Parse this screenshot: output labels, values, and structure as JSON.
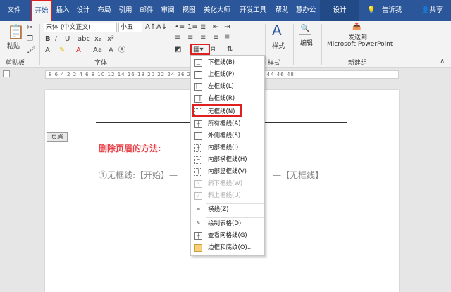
{
  "tabs": [
    "文件",
    "开始",
    "插入",
    "设计",
    "布局",
    "引用",
    "邮件",
    "审阅",
    "视图",
    "美化大师",
    "开发工具",
    "帮助",
    "慧办公",
    "设计"
  ],
  "active_tab": "开始",
  "tell_me": "告诉我",
  "share": "共享",
  "clipboard": {
    "paste_label": "粘贴",
    "group_label": "剪贴板"
  },
  "font": {
    "family": "宋体 (中文正文)",
    "size": "小五",
    "group_label": "字体",
    "aa_label": "Aa"
  },
  "styles": {
    "label": "样式",
    "group_label": "样式"
  },
  "editing": {
    "label": "编辑"
  },
  "send": {
    "line1": "发送到",
    "line2": "Microsoft PowerPoint",
    "group_label": "新建组"
  },
  "ruler_text": "8 6 4 2 2 4 6 8 10 12 14 16 18 20 22 24 26 28 30 32 34 36 38 40 42 44 46 48",
  "document": {
    "header_tag": "页眉",
    "heading": "删除页眉的方法:",
    "line_part1": "①无框线:【开始】—",
    "line_part2": "—【无框线】"
  },
  "border_menu": {
    "items": [
      {
        "label": "下框线(B)",
        "icon": "bottom-border-icon",
        "disabled": false
      },
      {
        "label": "上框线(P)",
        "icon": "top-border-icon",
        "disabled": false
      },
      {
        "label": "左框线(L)",
        "icon": "left-border-icon",
        "disabled": false
      },
      {
        "label": "右框线(R)",
        "icon": "right-border-icon",
        "disabled": false
      },
      {
        "label": "无框线(N)",
        "icon": "no-border-icon",
        "disabled": false
      },
      {
        "label": "所有框线(A)",
        "icon": "all-borders-icon",
        "disabled": false
      },
      {
        "label": "外侧框线(S)",
        "icon": "outside-borders-icon",
        "disabled": false
      },
      {
        "label": "内部框线(I)",
        "icon": "inside-borders-icon",
        "disabled": false
      },
      {
        "label": "内部横框线(H)",
        "icon": "inside-horizontal-border-icon",
        "disabled": false
      },
      {
        "label": "内部竖框线(V)",
        "icon": "inside-vertical-border-icon",
        "disabled": false
      },
      {
        "label": "斜下框线(W)",
        "icon": "diagonal-down-border-icon",
        "disabled": true
      },
      {
        "label": "斜上框线(U)",
        "icon": "diagonal-up-border-icon",
        "disabled": true
      },
      {
        "label": "横线(Z)",
        "icon": "horizontal-line-icon",
        "disabled": false
      },
      {
        "label": "绘制表格(D)",
        "icon": "draw-table-icon",
        "disabled": false
      },
      {
        "label": "查看网格线(G)",
        "icon": "view-gridlines-icon",
        "disabled": false
      },
      {
        "label": "边框和底纹(O)...",
        "icon": "borders-shading-icon",
        "disabled": false
      }
    ]
  },
  "colors": {
    "title_bar": "#2b579a",
    "highlight": "#e02020",
    "heading_red": "#e8434a"
  }
}
